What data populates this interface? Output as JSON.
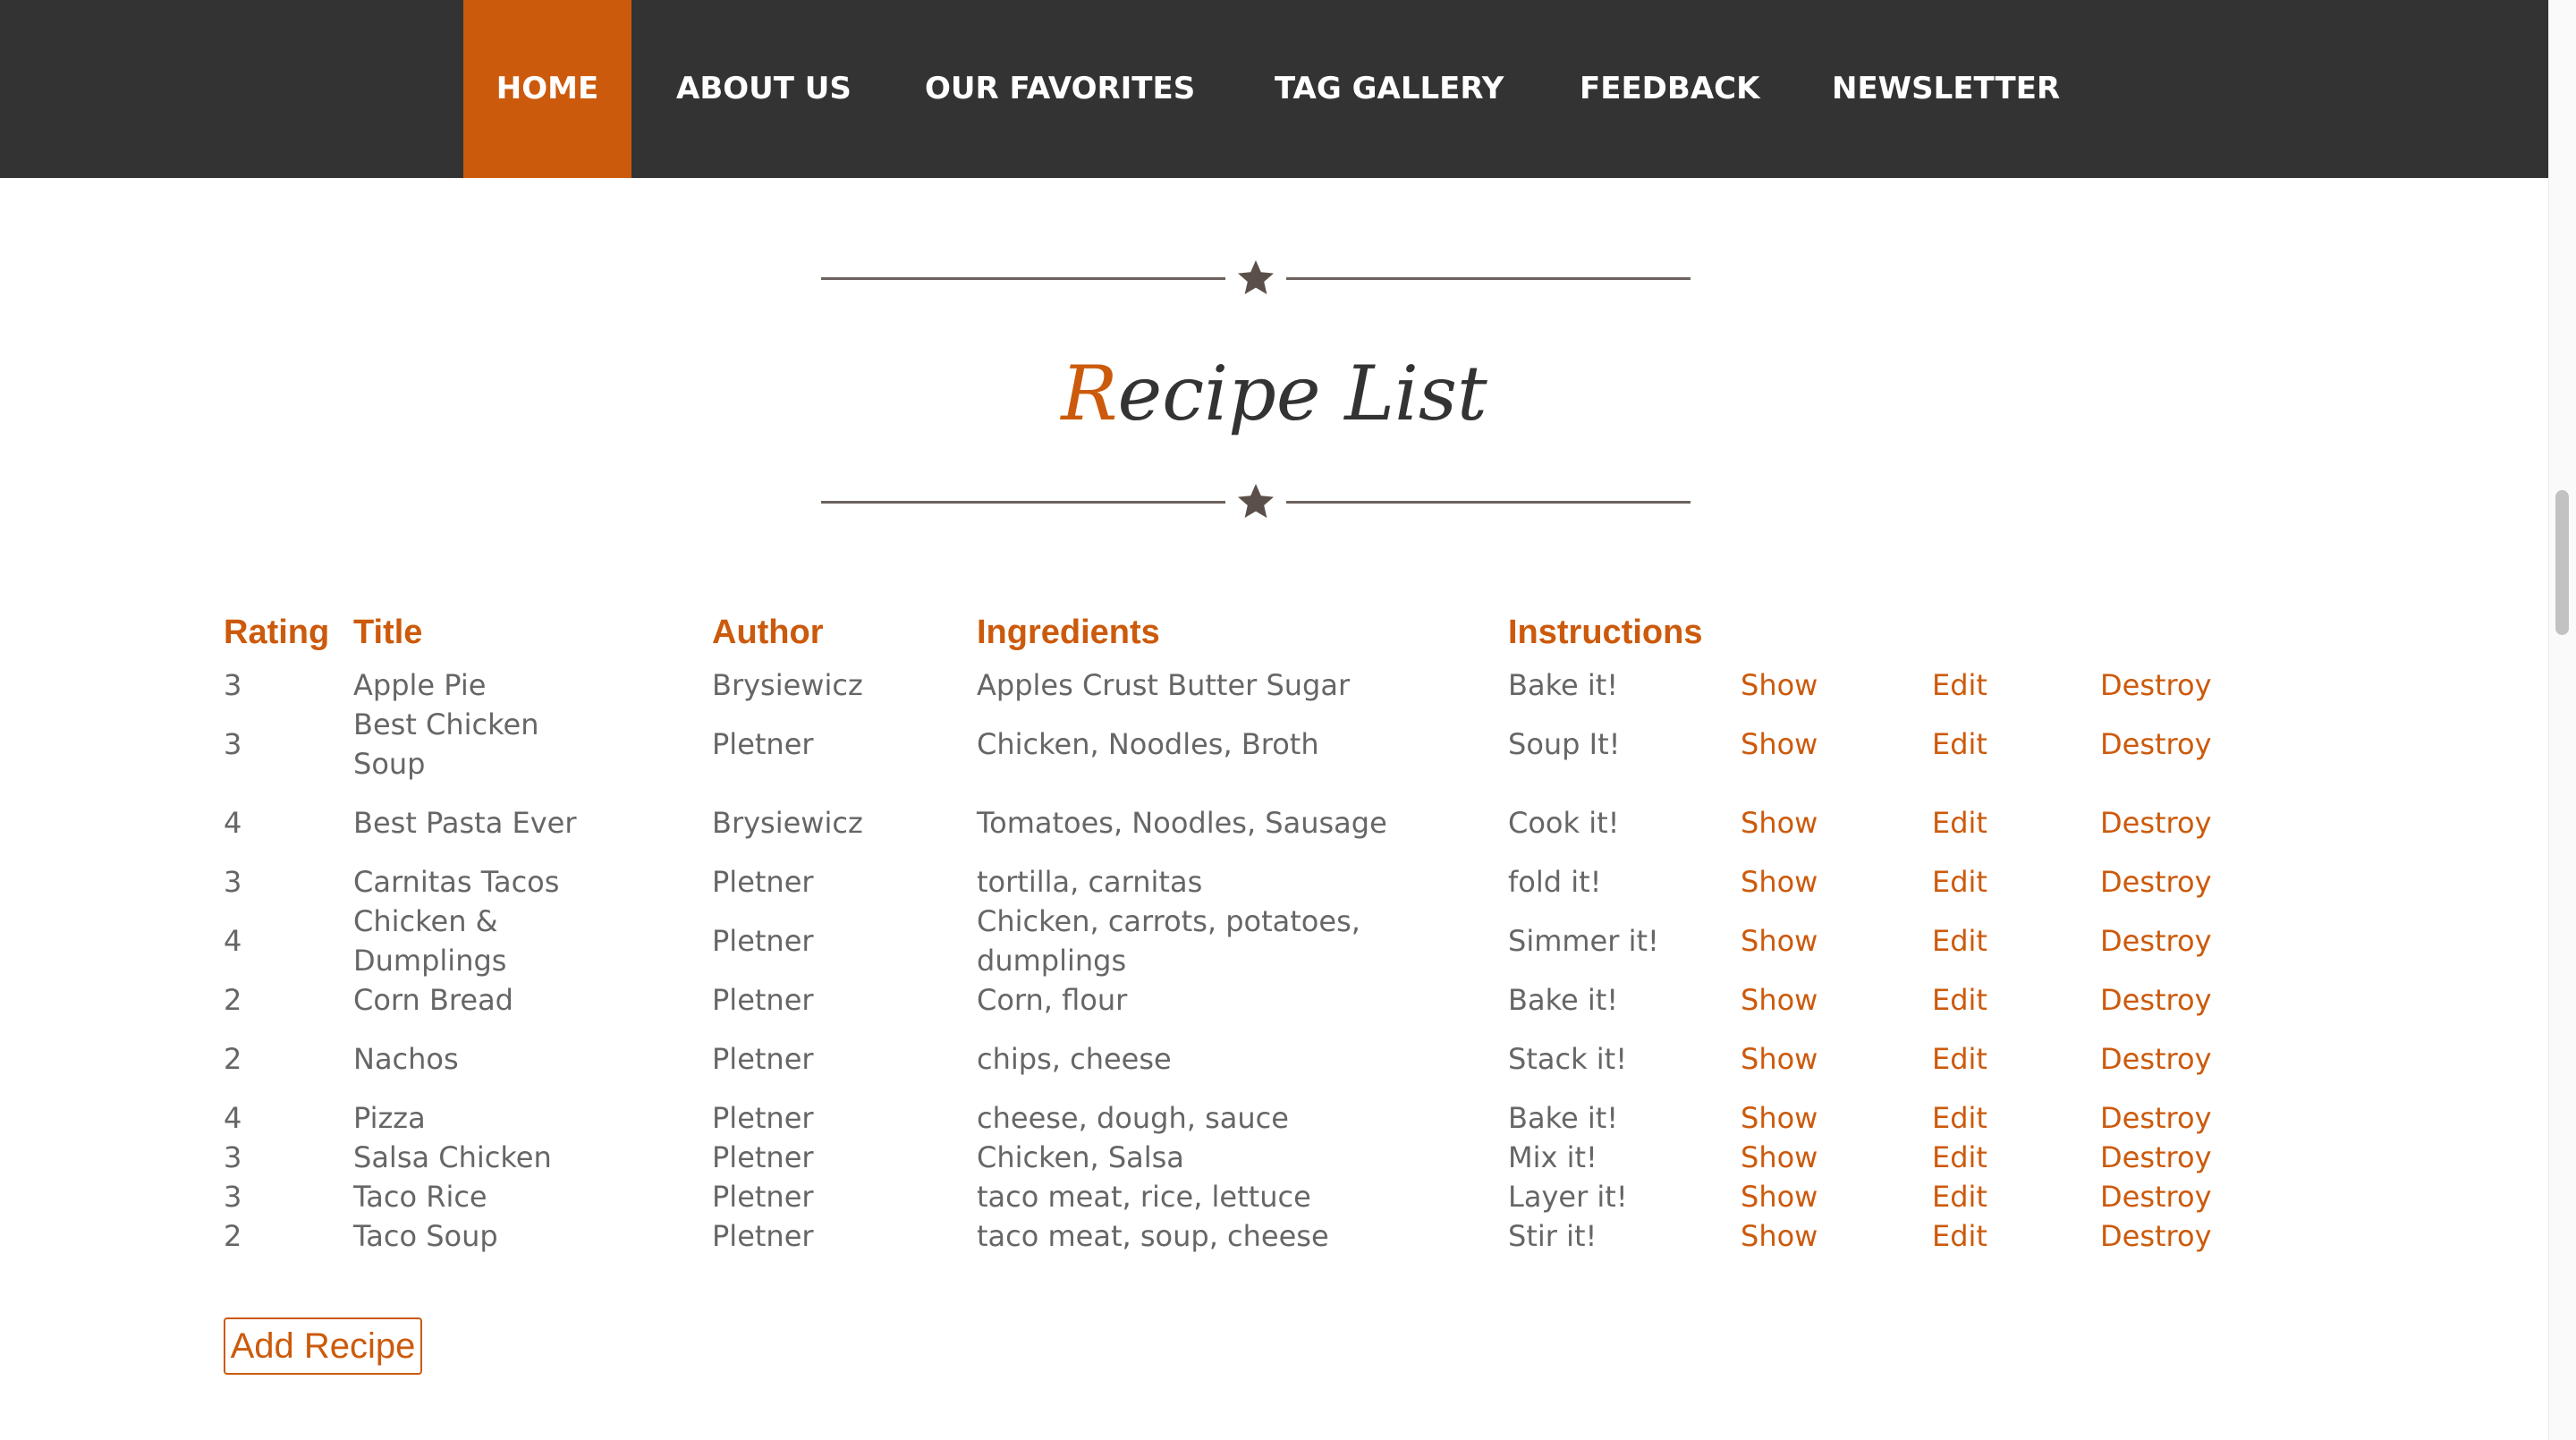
{
  "nav": {
    "items": [
      {
        "label": "HOME",
        "active": true
      },
      {
        "label": "ABOUT US"
      },
      {
        "label": "OUR FAVORITES"
      },
      {
        "label": "TAG GALLERY"
      },
      {
        "label": "FEEDBACK"
      },
      {
        "label": "NEWSLETTER"
      }
    ]
  },
  "page": {
    "title_first_letter": "R",
    "title_rest": "ecipe List"
  },
  "table": {
    "headers": [
      "Rating",
      "Title",
      "Author",
      "Ingredients",
      "Instructions"
    ],
    "actions": {
      "show": "Show",
      "edit": "Edit",
      "destroy": "Destroy"
    },
    "rows": [
      {
        "rating": "3",
        "title": "Apple Pie",
        "author": "Brysiewicz",
        "ingredients": "Apples Crust Butter Sugar",
        "instructions": "Bake it!"
      },
      {
        "rating": "3",
        "title": "Best Chicken Soup",
        "author": "Pletner",
        "ingredients": "Chicken, Noodles, Broth",
        "instructions": "Soup It!"
      },
      {
        "rating": "4",
        "title": "Best Pasta Ever",
        "author": "Brysiewicz",
        "ingredients": "Tomatoes, Noodles, Sausage",
        "instructions": "Cook it!"
      },
      {
        "rating": "3",
        "title": "Carnitas Tacos",
        "author": "Pletner",
        "ingredients": "tortilla, carnitas",
        "instructions": "fold it!"
      },
      {
        "rating": "4",
        "title": "Chicken & Dumplings",
        "author": "Pletner",
        "ingredients": "Chicken, carrots, potatoes, dumplings",
        "instructions": "Simmer it!"
      },
      {
        "rating": "2",
        "title": "Corn Bread",
        "author": "Pletner",
        "ingredients": "Corn, flour",
        "instructions": "Bake it!"
      },
      {
        "rating": "2",
        "title": "Nachos",
        "author": "Pletner",
        "ingredients": "chips, cheese",
        "instructions": "Stack it!"
      },
      {
        "rating": "4",
        "title": "Pizza",
        "author": "Pletner",
        "ingredients": "cheese, dough, sauce",
        "instructions": "Bake it!"
      },
      {
        "rating": "3",
        "title": "Salsa Chicken",
        "author": "Pletner",
        "ingredients": "Chicken, Salsa",
        "instructions": "Mix it!"
      },
      {
        "rating": "3",
        "title": "Taco Rice",
        "author": "Pletner",
        "ingredients": "taco meat, rice, lettuce",
        "instructions": "Layer it!"
      },
      {
        "rating": "2",
        "title": "Taco Soup",
        "author": "Pletner",
        "ingredients": "taco meat, soup, cheese",
        "instructions": "Stir it!"
      }
    ]
  },
  "add_button": {
    "label": "Add Recipe"
  },
  "colors": {
    "accent": "#cc5a0c",
    "nav_bg": "#333333",
    "text": "#666666"
  }
}
